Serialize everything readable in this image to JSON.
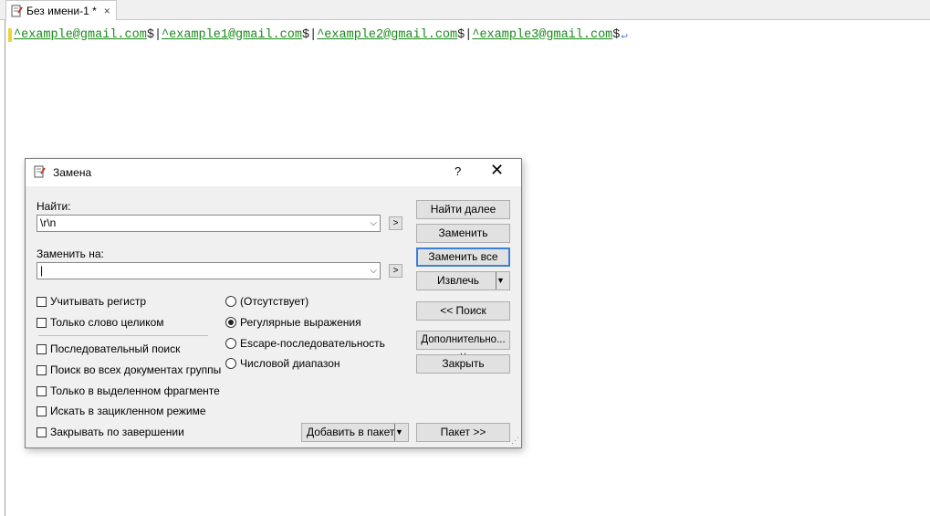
{
  "tab": {
    "title": "Без имени-1 *",
    "close": "×"
  },
  "editor": {
    "tokens": [
      {
        "text": "^example@gmail.com",
        "after": "$"
      },
      {
        "text": "^example1@gmail.com",
        "after": "$"
      },
      {
        "text": "^example2@gmail.com",
        "after": "$"
      },
      {
        "text": "^example3@gmail.com",
        "after": "$"
      }
    ],
    "pipe": "|",
    "eol": "↵"
  },
  "dialog": {
    "title": "Замена",
    "help": "?",
    "close": "✕",
    "find_label": "Найти:",
    "find_value": "\\r\\n",
    "replace_label": "Заменить на:",
    "replace_value": "|",
    "arrow": ">",
    "dropdown": "⌵",
    "checkboxes": [
      "Учитывать регистр",
      "Только слово целиком",
      "Последовательный поиск",
      "Поиск во всех документах группы",
      "Только в выделенном фрагменте",
      "Искать в зацикленном режиме",
      "Закрывать по завершении"
    ],
    "radios": [
      "(Отсутствует)",
      "Регулярные выражения",
      "Escape-последовательность",
      "Числовой диапазон"
    ],
    "selected_radio": "Регулярные выражения",
    "buttons": {
      "find_next": "Найти далее",
      "replace": "Заменить",
      "replace_all": "Заменить все",
      "extract": "Извлечь",
      "search": "<< Поиск",
      "more": "Дополнительно... ˅",
      "close": "Закрыть",
      "add_to_batch": "Добавить в пакет",
      "batch": "Пакет >>"
    }
  }
}
